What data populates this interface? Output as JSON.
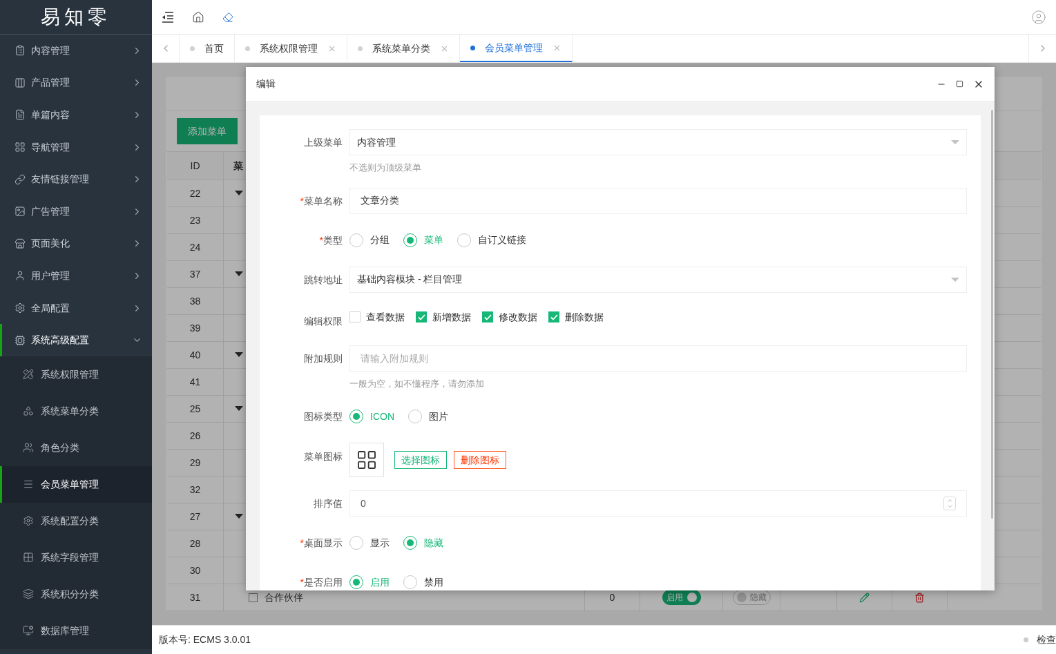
{
  "logo": "易知零",
  "sidebar": {
    "items": [
      {
        "label": "内容管理",
        "expanded": false
      },
      {
        "label": "产品管理",
        "expanded": false
      },
      {
        "label": "单篇内容",
        "expanded": false
      },
      {
        "label": "导航管理",
        "expanded": false
      },
      {
        "label": "友情链接管理",
        "expanded": false
      },
      {
        "label": "广告管理",
        "expanded": false
      },
      {
        "label": "页面美化",
        "expanded": false
      },
      {
        "label": "用户管理",
        "expanded": false
      },
      {
        "label": "全局配置",
        "expanded": false
      },
      {
        "label": "系统高级配置",
        "expanded": true,
        "children": [
          {
            "label": "系统权限管理",
            "selected": false
          },
          {
            "label": "系统菜单分类",
            "selected": false
          },
          {
            "label": "角色分类",
            "selected": false
          },
          {
            "label": "会员菜单管理",
            "selected": true
          },
          {
            "label": "系统配置分类",
            "selected": false
          },
          {
            "label": "系统字段管理",
            "selected": false
          },
          {
            "label": "系统积分分类",
            "selected": false
          },
          {
            "label": "数据库管理",
            "selected": false
          }
        ]
      }
    ]
  },
  "tabs": [
    {
      "label": "首页",
      "selected": false,
      "closable": false
    },
    {
      "label": "系统权限管理",
      "selected": false,
      "closable": true
    },
    {
      "label": "系统菜单分类",
      "selected": false,
      "closable": true
    },
    {
      "label": "会员菜单管理",
      "selected": true,
      "closable": true
    }
  ],
  "page": {
    "add_button": "添加菜单",
    "table": {
      "columns": [
        "ID",
        "菜"
      ],
      "rows": [
        {
          "id": "22",
          "kind": "group"
        },
        {
          "id": "23",
          "kind": "item"
        },
        {
          "id": "24",
          "kind": "item"
        },
        {
          "id": "37",
          "kind": "group"
        },
        {
          "id": "38",
          "kind": "item"
        },
        {
          "id": "39",
          "kind": "item"
        },
        {
          "id": "40",
          "kind": "group"
        },
        {
          "id": "41",
          "kind": "item"
        },
        {
          "id": "25",
          "kind": "group"
        },
        {
          "id": "26",
          "kind": "item"
        },
        {
          "id": "29",
          "kind": "item"
        },
        {
          "id": "32",
          "kind": "item"
        },
        {
          "id": "27",
          "kind": "group"
        },
        {
          "id": "28",
          "kind": "item"
        },
        {
          "id": "30",
          "kind": "item"
        },
        {
          "id": "31",
          "kind": "item",
          "checked": false,
          "name": "合作伙伴",
          "sort": "0",
          "enabled": {
            "label": "启用",
            "on": true
          },
          "display": {
            "label": "隐藏",
            "on": false
          }
        }
      ]
    }
  },
  "modal": {
    "title": "编辑",
    "fields": [
      {
        "kind": "select",
        "label": "上级菜单",
        "value": "内容管理",
        "help": "不选则为顶级菜单"
      },
      {
        "kind": "input",
        "required_mark": "*",
        "label": "菜单名称",
        "value": "文章分类"
      },
      {
        "kind": "radio",
        "required_mark": "*",
        "label": "类型",
        "options": [
          {
            "label": "分组",
            "selected": false
          },
          {
            "label": "菜单",
            "selected": true
          },
          {
            "label": "自订义链接",
            "selected": false
          }
        ]
      },
      {
        "kind": "select",
        "label": "跳转地址",
        "value": "基础内容模块 - 栏目管理"
      },
      {
        "kind": "checkbox",
        "label": "编辑权限",
        "options": [
          {
            "label": "查看数据",
            "checked": false
          },
          {
            "label": "新增数据",
            "checked": true
          },
          {
            "label": "修改数据",
            "checked": true
          },
          {
            "label": "删除数据",
            "checked": true
          }
        ]
      },
      {
        "kind": "input",
        "label": "附加规则",
        "placeholder": "请输入附加规则",
        "help": "一般为空，如不懂程序，请勿添加"
      },
      {
        "kind": "radio",
        "label": "图标类型",
        "options": [
          {
            "label": "ICON",
            "selected": true
          },
          {
            "label": "图片",
            "selected": false
          }
        ]
      },
      {
        "kind": "icon",
        "label": "菜单图标",
        "choose": "选择图标",
        "remove": "删除图标"
      },
      {
        "kind": "number",
        "label": "排序值",
        "value": "0"
      },
      {
        "kind": "radio",
        "required_mark": "*",
        "label": "桌面显示",
        "options": [
          {
            "label": "显示",
            "selected": false
          },
          {
            "label": "隐藏",
            "selected": true
          }
        ]
      },
      {
        "kind": "radio",
        "required_mark": "*",
        "label": "是否启用",
        "options": [
          {
            "label": "启用",
            "selected": true
          },
          {
            "label": "禁用",
            "selected": false
          }
        ]
      }
    ]
  },
  "footer": {
    "version": "版本号: ECMS 3.0.01",
    "status": "检查"
  }
}
